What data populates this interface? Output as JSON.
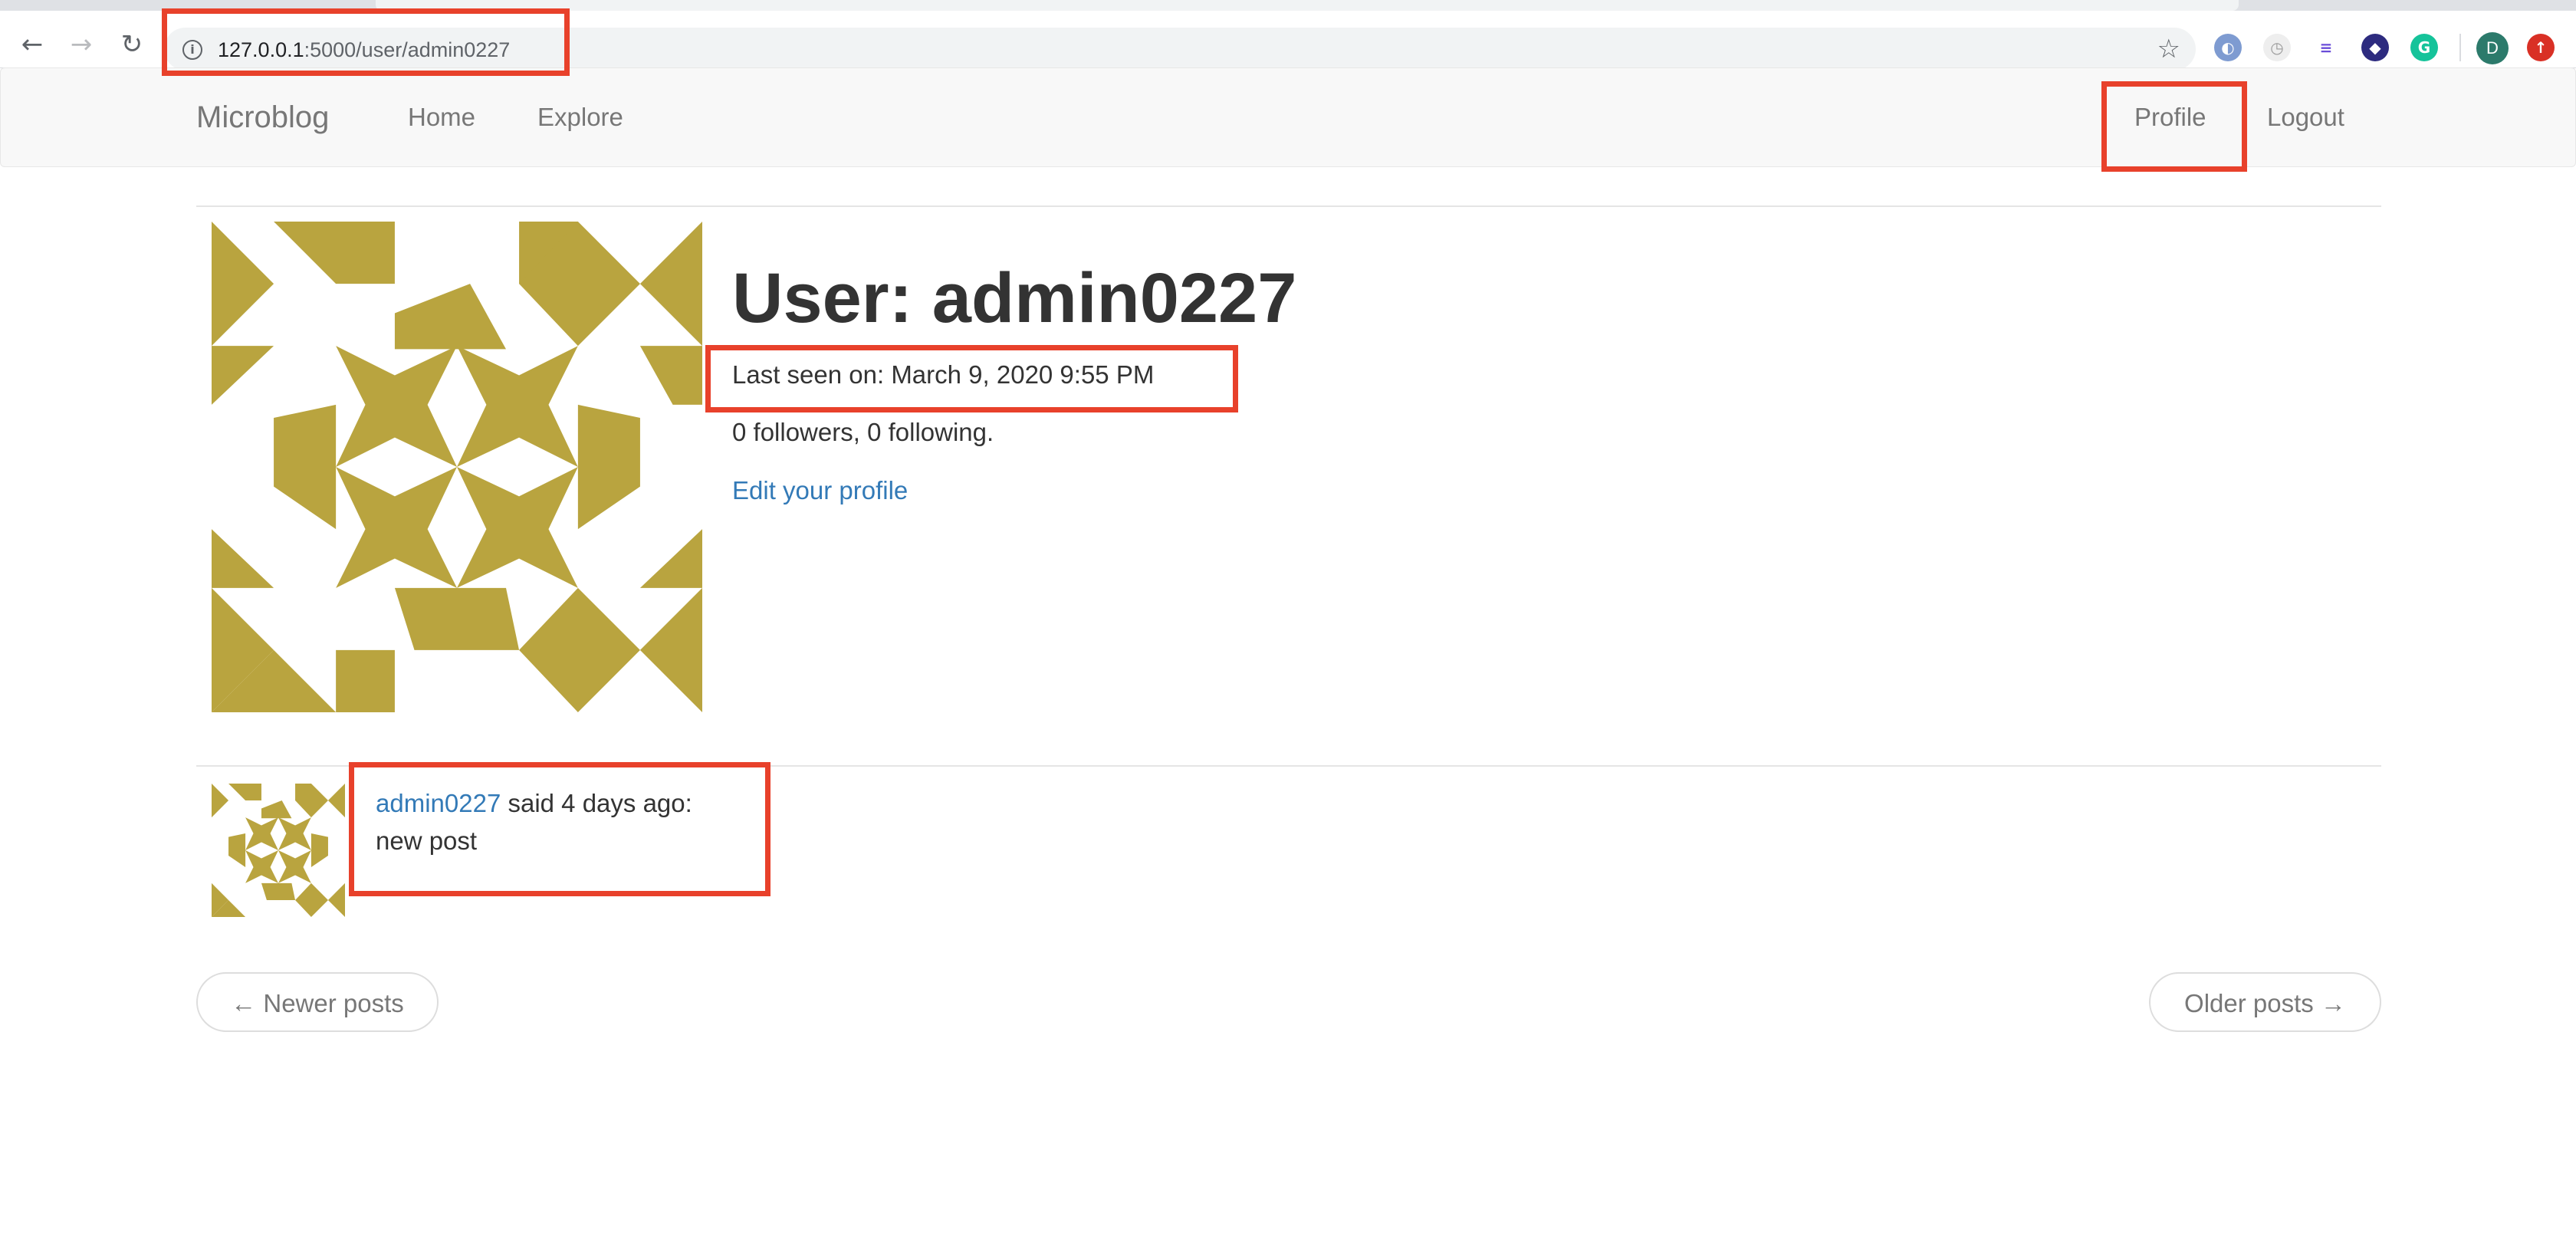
{
  "browser": {
    "back_icon": "arrow-left-icon",
    "forward_icon": "arrow-right-icon",
    "reload_icon": "reload-icon",
    "url_host": "127.0.0.1",
    "url_path": ":5000/user/admin0227",
    "bookmark_icon": "star-icon",
    "profile_initial": "D",
    "extensions": [
      "extension-1-icon",
      "extension-2-icon",
      "extension-3-icon",
      "extension-4-icon",
      "grammarly-icon",
      "extension-6-icon"
    ]
  },
  "navbar": {
    "brand": "Microblog",
    "home": "Home",
    "explore": "Explore",
    "profile": "Profile",
    "logout": "Logout"
  },
  "profile": {
    "title": "User: admin0227",
    "last_seen": "Last seen on: March 9, 2020 9:55 PM",
    "follow_counts": "0 followers, 0 following.",
    "edit_link": "Edit your profile",
    "avatar_color": "#b9a43f"
  },
  "posts": [
    {
      "author": "admin0227",
      "meta": " said 4 days ago:",
      "body": "new post"
    }
  ],
  "pager": {
    "newer": "← Newer posts",
    "older": "Older posts →"
  },
  "annotation_color": "#e8412b"
}
